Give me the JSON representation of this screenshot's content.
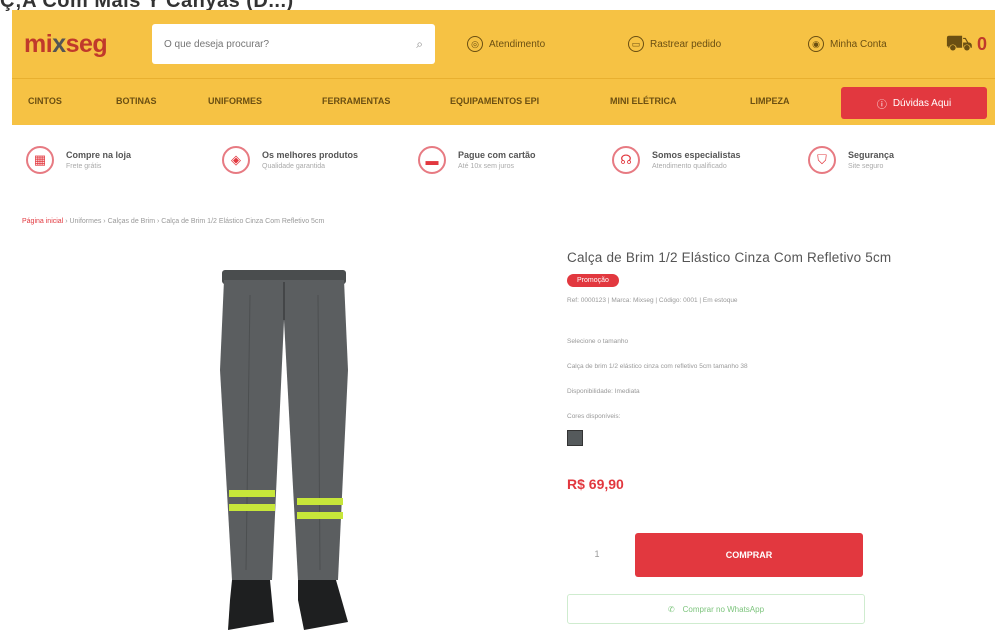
{
  "page": {
    "heading": "Ç;A Com Mais Y Canyas (D...)"
  },
  "header": {
    "logo": {
      "part1": "mi",
      "part2": "x",
      "part3": "seg"
    },
    "search_placeholder": "O que deseja procurar?",
    "nav": [
      {
        "icon": "location-icon",
        "label": "Atendimento"
      },
      {
        "icon": "truck-icon",
        "label": "Rastrear pedido"
      },
      {
        "icon": "user-icon",
        "label": "Minha Conta"
      }
    ],
    "cart": {
      "icon": "cart-icon",
      "count": "0"
    }
  },
  "categories": {
    "items": [
      "CINTOS",
      "BOTINAS",
      "UNIFORMES",
      "FERRAMENTAS",
      "EQUIPAMENTOS EPI",
      "MINI ELÉTRICA",
      "LIMPEZA"
    ],
    "help_label": "Dúvidas Aqui"
  },
  "benefits": [
    {
      "icon": "store-icon",
      "title": "Compre na loja",
      "sub": "Frete grátis"
    },
    {
      "icon": "box-icon",
      "title": "Os melhores produtos",
      "sub": "Qualidade garantida"
    },
    {
      "icon": "card-icon",
      "title": "Pague com cartão",
      "sub": "Até 10x sem juros"
    },
    {
      "icon": "headset-icon",
      "title": "Somos especialistas",
      "sub": "Atendimento qualificado"
    },
    {
      "icon": "shield-icon",
      "title": "Segurança",
      "sub": "Site seguro"
    }
  ],
  "breadcrumb": {
    "home": "Página inicial",
    "rest": " › Uniformes › Calças de Brim › Calça de Brim 1/2 Elástico Cinza Com Refletivo 5cm"
  },
  "product": {
    "title": "Calça de Brim 1/2 Elástico Cinza Com Refletivo 5cm",
    "badge": "Promoção",
    "meta": "Ref: 0000123 | Marca: Mixseg | Código: 0001 | Em estoque",
    "lines": [
      "Selecione o tamanho",
      "Calça de brim 1/2 elástico cinza com refletivo 5cm tamanho 38",
      "Disponibilidade: Imediata",
      "Cores disponíveis:"
    ],
    "price": "R$ 69,90",
    "qty": "1",
    "buy_label": "COMPRAR",
    "whatsapp_label": "Comprar no WhatsApp",
    "swatch_color": "#555a5c"
  }
}
